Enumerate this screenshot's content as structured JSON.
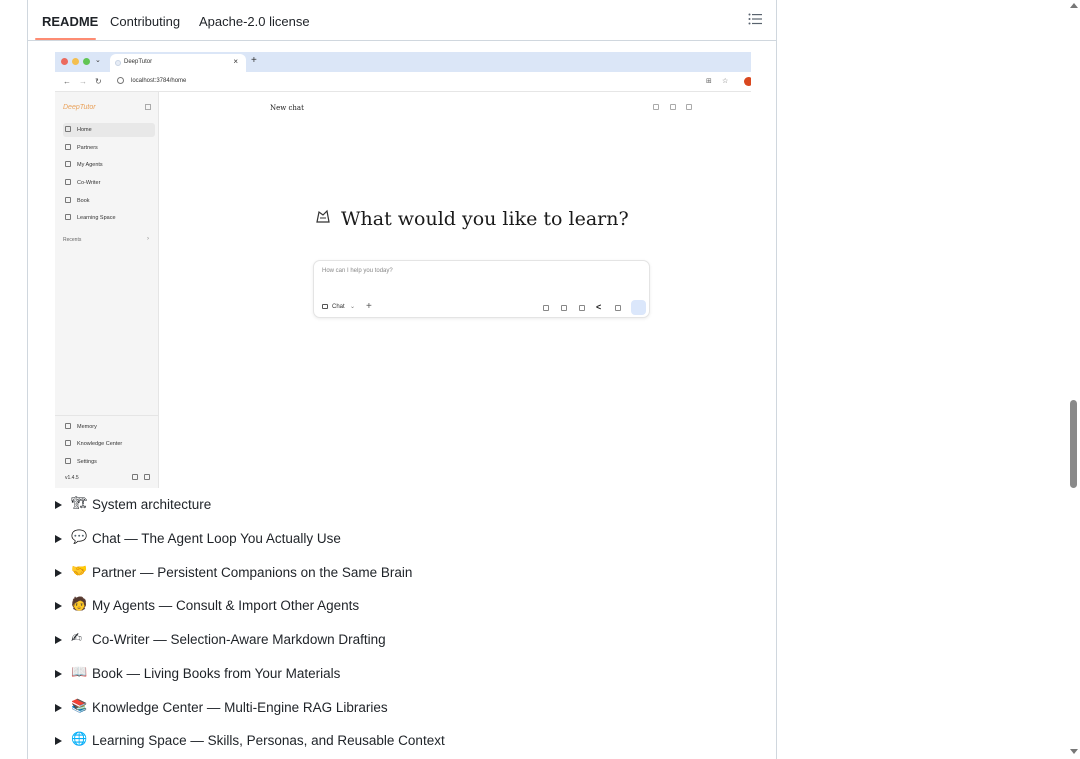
{
  "tabs": [
    {
      "label": "README",
      "active": true
    },
    {
      "label": "Contributing",
      "active": false
    },
    {
      "label": "Apache-2.0 license",
      "active": false
    }
  ],
  "toc_icon": "list-icon",
  "screenshot": {
    "browser_tab_title": "DeepTutor",
    "url": "localhost:3784/home",
    "app": {
      "logo": "DeepTutor",
      "nav": [
        {
          "label": "Home",
          "active": true,
          "icon": "home-icon"
        },
        {
          "label": "Partners",
          "active": false,
          "icon": "heart-icon"
        },
        {
          "label": "My Agents",
          "active": false,
          "icon": "bot-icon"
        },
        {
          "label": "Co-Writer",
          "active": false,
          "icon": "pen-icon"
        },
        {
          "label": "Book",
          "active": false,
          "icon": "book-icon"
        },
        {
          "label": "Learning Space",
          "active": false,
          "icon": "grid-icon"
        }
      ],
      "recents_label": "Recents",
      "bottom_nav": [
        {
          "label": "Memory",
          "icon": "brain-icon"
        },
        {
          "label": "Knowledge Center",
          "icon": "book-open-icon"
        },
        {
          "label": "Settings",
          "icon": "gear-icon"
        }
      ],
      "version": "v1.4.5",
      "page_title": "New chat",
      "welcome": "What would you like to learn?",
      "chat_placeholder": "How can I help you today?",
      "chat_mode": "Chat"
    }
  },
  "sections": [
    {
      "emoji": "🏗",
      "label": "System architecture"
    },
    {
      "emoji": "💬",
      "label": "Chat — The Agent Loop You Actually Use"
    },
    {
      "emoji": "🤝",
      "label": "Partner — Persistent Companions on the Same Brain"
    },
    {
      "emoji": "🧑",
      "label": "My Agents — Consult & Import Other Agents"
    },
    {
      "emoji": "✍",
      "label": "Co-Writer — Selection-Aware Markdown Drafting"
    },
    {
      "emoji": "📖",
      "label": "Book — Living Books from Your Materials"
    },
    {
      "emoji": "📚",
      "label": "Knowledge Center — Multi-Engine RAG Libraries"
    },
    {
      "emoji": "🌐",
      "label": "Learning Space — Skills, Personas, and Reusable Context"
    }
  ]
}
